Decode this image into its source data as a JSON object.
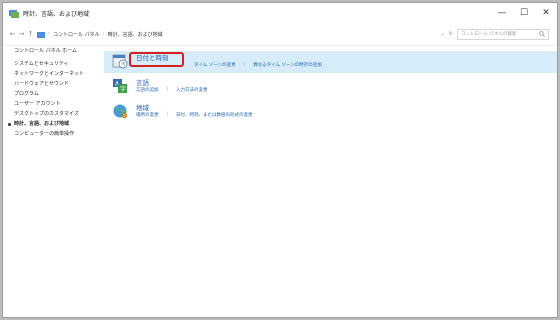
{
  "window": {
    "title": "時計、言語、および地域",
    "controls": [
      "—",
      "☐",
      "✕"
    ]
  },
  "address": {
    "back": "←",
    "forward": "→",
    "up_arrow": "↑",
    "crumbs": [
      "コントロール パネル",
      "時計、言語、および地域"
    ],
    "dropdown": "⌄",
    "refresh": "↻",
    "search_placeholder": "コントロール パネルの検索"
  },
  "sidebar": {
    "items": [
      {
        "label": "コントロール パネル ホーム"
      },
      {
        "label": "システムとセキュリティ"
      },
      {
        "label": "ネットワークとインターネット"
      },
      {
        "label": "ハードウェアとサウンド"
      },
      {
        "label": "プログラム"
      },
      {
        "label": "ユーザー アカウント"
      },
      {
        "label": "デスクトップのカスタマイズ"
      },
      {
        "label": "時計、言語、および地域"
      },
      {
        "label": "コンピューターの簡単操作"
      }
    ]
  },
  "categories": [
    {
      "title": "日付と時刻",
      "links": [
        "タイム ゾーンの変更",
        "異なるタイム ゾーンの時計の追加"
      ]
    },
    {
      "title": "言語",
      "links": [
        "言語の追加",
        "入力方法の変更"
      ]
    },
    {
      "title": "地域",
      "links": [
        "場所の変更",
        "日付、時刻、または数値の形式の変更"
      ]
    }
  ],
  "colors": {
    "link": "#1d5fb0",
    "highlight": "#d6ecf8",
    "callout": "#d42020"
  }
}
